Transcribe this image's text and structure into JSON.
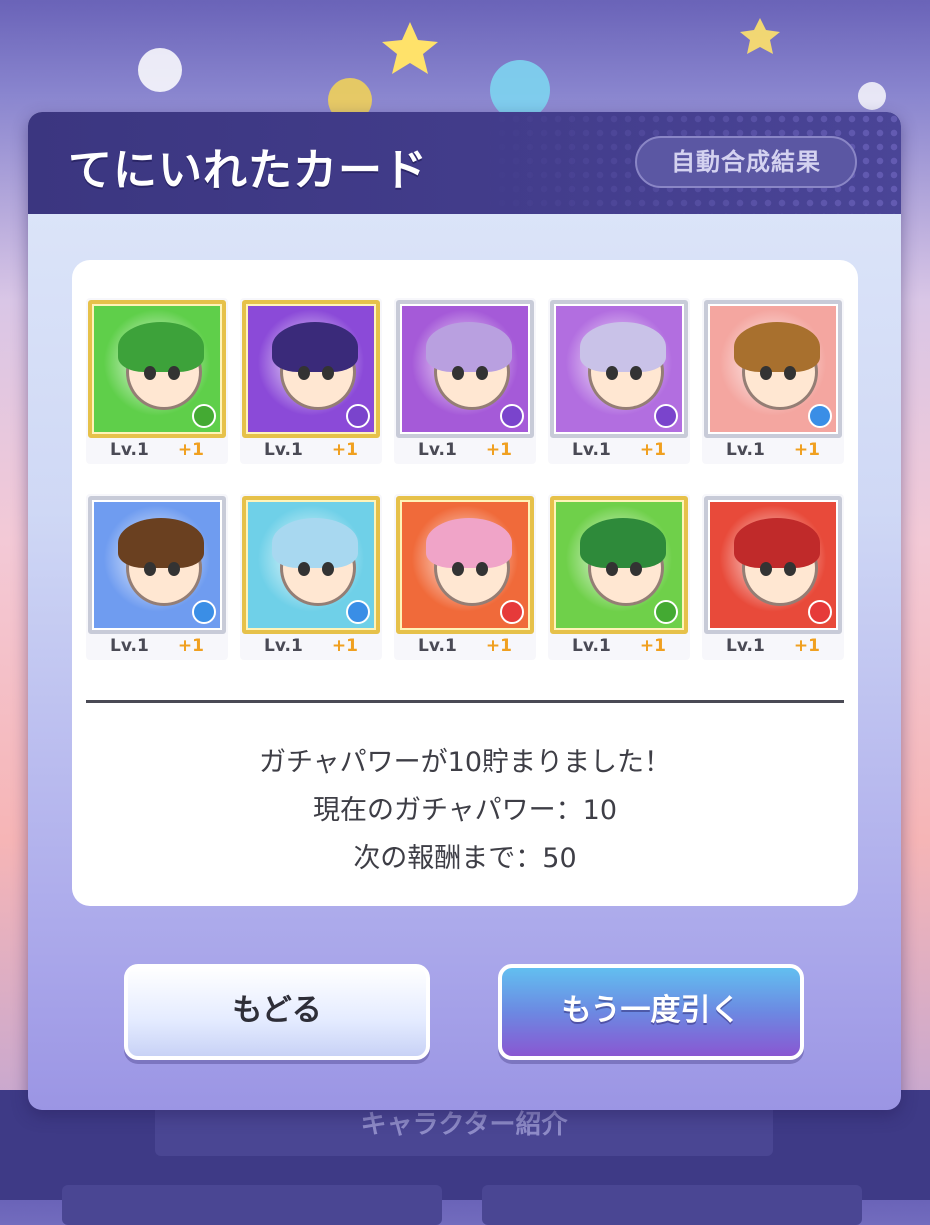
{
  "dialog": {
    "title": "てにいれたカード",
    "auto_compose_button": "自動合成結果"
  },
  "cards": [
    {
      "level": "Lv.1",
      "plus": "+1",
      "frame": "gold",
      "bg": "#5fcf4a",
      "hair": "#3da23a",
      "orb": "#44aa33"
    },
    {
      "level": "Lv.1",
      "plus": "+1",
      "frame": "gold",
      "bg": "#8b4ad8",
      "hair": "#3a2a7a",
      "orb": "#7a44cc"
    },
    {
      "level": "Lv.1",
      "plus": "+1",
      "frame": "silver",
      "bg": "#a55ad8",
      "hair": "#b9a0e0",
      "orb": "#7a44cc"
    },
    {
      "level": "Lv.1",
      "plus": "+1",
      "frame": "silver",
      "bg": "#b26ee0",
      "hair": "#c9c2e8",
      "orb": "#7a44cc"
    },
    {
      "level": "Lv.1",
      "plus": "+1",
      "frame": "silver",
      "bg": "#f4a6a0",
      "hair": "#a8702e",
      "orb": "#3a8ee6"
    },
    {
      "level": "Lv.1",
      "plus": "+1",
      "frame": "silver",
      "bg": "#6f9cf0",
      "hair": "#6a4020",
      "orb": "#3a8ee6"
    },
    {
      "level": "Lv.1",
      "plus": "+1",
      "frame": "gold",
      "bg": "#6fd0e8",
      "hair": "#a8d8f0",
      "orb": "#3a8ee6"
    },
    {
      "level": "Lv.1",
      "plus": "+1",
      "frame": "gold",
      "bg": "#f06a3a",
      "hair": "#f0a4c8",
      "orb": "#e63a3a"
    },
    {
      "level": "Lv.1",
      "plus": "+1",
      "frame": "gold",
      "bg": "#6fd04a",
      "hair": "#2e8a3a",
      "orb": "#44aa33"
    },
    {
      "level": "Lv.1",
      "plus": "+1",
      "frame": "silver",
      "bg": "#e84a3a",
      "hair": "#c02a2a",
      "orb": "#e63a3a"
    }
  ],
  "result": {
    "line1": "ガチャパワーが10貯まりました！",
    "line2": "現在のガチャパワー：10",
    "line3": "次の報酬まで：50"
  },
  "buttons": {
    "back": "もどる",
    "again": "もう一度引く"
  },
  "background": {
    "bar_label": "キャラクター紹介"
  }
}
